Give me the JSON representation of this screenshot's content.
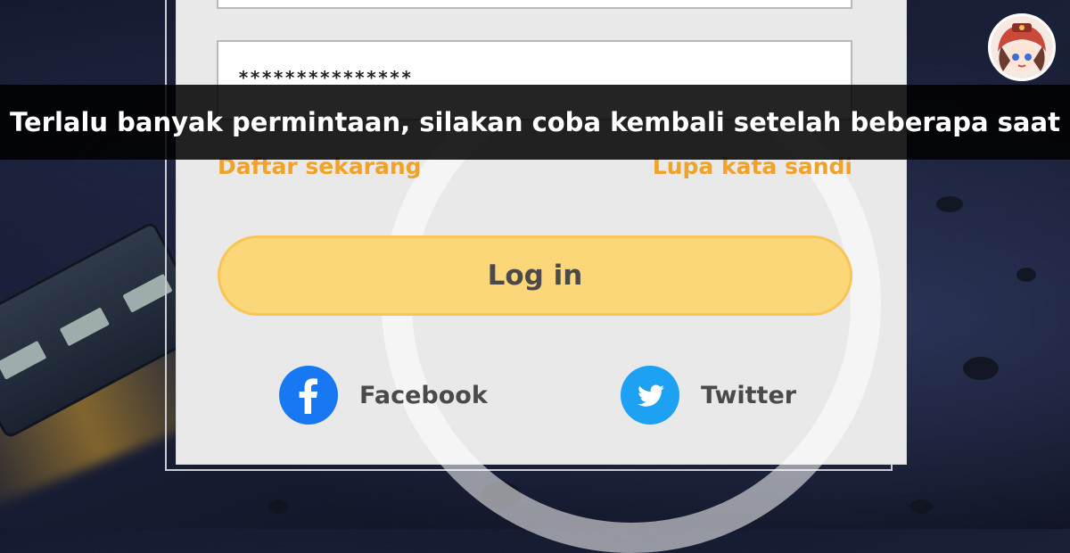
{
  "login_form": {
    "password_value": "***************",
    "register_link": "Daftar sekarang",
    "forgot_link": "Lupa kata sandi",
    "login_button": "Log in",
    "facebook_label": "Facebook",
    "twitter_label": "Twitter"
  },
  "toast": {
    "message": "Terlalu banyak permintaan, silakan coba kembali setelah beberapa saat"
  },
  "icons": {
    "facebook": "facebook-icon",
    "twitter": "twitter-icon",
    "avatar": "user-avatar"
  },
  "colors": {
    "link": "#f0a32a",
    "login_button": "#fbd77a",
    "facebook": "#1877f2",
    "twitter": "#1da1f2"
  }
}
